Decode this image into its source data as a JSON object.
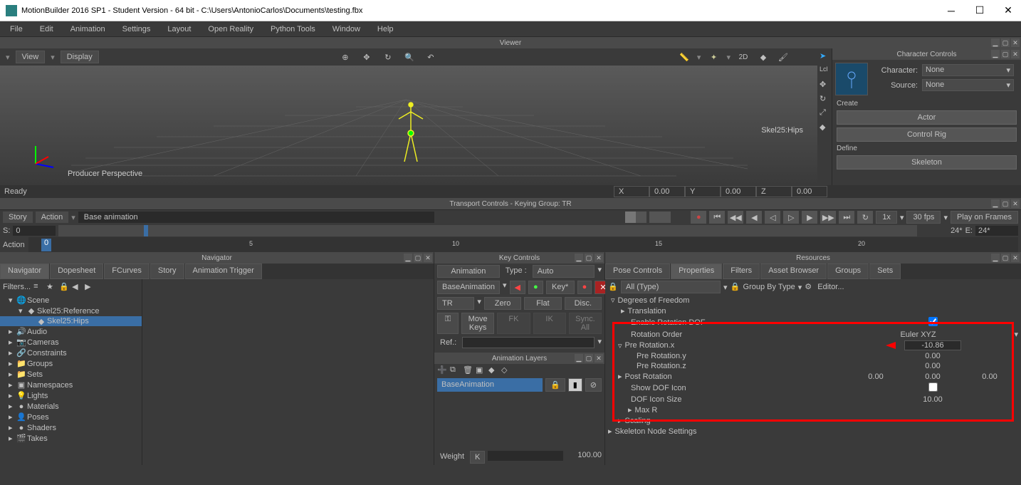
{
  "titlebar": {
    "title": "MotionBuilder 2016 SP1 - Student Version    - 64 bit  - C:\\Users\\AntonioCarlos\\Documents\\testing.fbx"
  },
  "menubar": {
    "items": [
      "File",
      "Edit",
      "Animation",
      "Settings",
      "Layout",
      "Open Reality",
      "Python Tools",
      "Window",
      "Help"
    ]
  },
  "viewer": {
    "title": "Viewer",
    "view_btn": "View",
    "display_btn": "Display",
    "perspective": "Producer Perspective",
    "skeleton_label": "Skel25:Hips",
    "tool_2d": "2D"
  },
  "char_controls": {
    "title": "Character Controls",
    "character_label": "Character:",
    "character_value": "None",
    "source_label": "Source:",
    "source_value": "None",
    "create_label": "Create",
    "actor_btn": "Actor",
    "control_rig_btn": "Control Rig",
    "define_label": "Define",
    "skeleton_btn": "Skeleton"
  },
  "status": {
    "ready": "Ready",
    "x": "X",
    "x_val": "0.00",
    "y": "Y",
    "y_val": "0.00",
    "z": "Z",
    "z_val": "0.00"
  },
  "transport": {
    "title": "Transport Controls  -  Keying Group: TR",
    "story": "Story",
    "action": "Action",
    "base_anim": "Base animation",
    "action_label": "Action",
    "s_label": "S:",
    "s_val": "0",
    "marker_val": "0",
    "rate": "1x",
    "fps": "30 fps",
    "play_mode": "Play on Frames",
    "range_a": "24*",
    "range_e_label": "E:",
    "range_e": "24*",
    "tick_5": "5",
    "tick_10": "10",
    "tick_15": "15",
    "tick_20": "20"
  },
  "navigator": {
    "title": "Navigator",
    "tabs": [
      "Navigator",
      "Dopesheet",
      "FCurves",
      "Story",
      "Animation Trigger"
    ],
    "filters_label": "Filters...",
    "tree": [
      {
        "indent": 0,
        "icon": "🌐",
        "label": "Scene",
        "expanded": true
      },
      {
        "indent": 1,
        "icon": "◆",
        "label": "Skel25:Reference",
        "expanded": true
      },
      {
        "indent": 2,
        "icon": "◆",
        "label": "Skel25:Hips",
        "selected": true
      },
      {
        "indent": 0,
        "icon": "🔊",
        "label": "Audio"
      },
      {
        "indent": 0,
        "icon": "📷",
        "label": "Cameras"
      },
      {
        "indent": 0,
        "icon": "🔗",
        "label": "Constraints"
      },
      {
        "indent": 0,
        "icon": "📁",
        "label": "Groups"
      },
      {
        "indent": 0,
        "icon": "📁",
        "label": "Sets"
      },
      {
        "indent": 0,
        "icon": "▣",
        "label": "Namespaces"
      },
      {
        "indent": 0,
        "icon": "💡",
        "label": "Lights"
      },
      {
        "indent": 0,
        "icon": "●",
        "label": "Materials"
      },
      {
        "indent": 0,
        "icon": "👤",
        "label": "Poses"
      },
      {
        "indent": 0,
        "icon": "●",
        "label": "Shaders"
      },
      {
        "indent": 0,
        "icon": "🎬",
        "label": "Takes"
      }
    ]
  },
  "key_controls": {
    "title": "Key Controls",
    "animation_btn": "Animation",
    "type_label": "Type :",
    "type_val": "Auto",
    "layer": "BaseAnimation",
    "key_btn": "Key*",
    "tr_label": "TR",
    "zero": "Zero",
    "flat": "Flat",
    "disc": "Disc.",
    "move_keys": "Move Keys",
    "fk": "FK",
    "ik": "IK",
    "sync": "Sync. All",
    "ref_label": "Ref.:"
  },
  "anim_layers": {
    "title": "Animation Layers",
    "layer_name": "BaseAnimation",
    "weight_label": "Weight",
    "weight_val": "100.00"
  },
  "resources": {
    "title": "Resources",
    "tabs": [
      "Pose Controls",
      "Properties",
      "Filters",
      "Asset Browser",
      "Groups",
      "Sets"
    ],
    "filter_all": "All (Type)",
    "group_by": "Group By Type",
    "editor": "Editor...",
    "props": {
      "dof_header": "Degrees of Freedom",
      "translation": "Translation",
      "enable_rot_dof": "Enable Rotation DOF",
      "rotation_order": "Rotation Order",
      "rotation_order_val": "Euler XYZ",
      "pre_rot_x": "Pre Rotation.x",
      "pre_rot_x_val": "-10.86",
      "pre_rot_y": "Pre Rotation.y",
      "pre_rot_y_val": "0.00",
      "pre_rot_z": "Pre Rotation.z",
      "pre_rot_z_val": "0.00",
      "post_rotation": "Post Rotation",
      "post_rot_vals": [
        "0.00",
        "0.00",
        "0.00"
      ],
      "show_dof": "Show DOF Icon",
      "dof_size": "DOF Icon Size",
      "dof_size_val": "10.00",
      "max_r": "Max R",
      "scaling": "Scaling",
      "skel_settings": "Skeleton Node Settings"
    }
  }
}
